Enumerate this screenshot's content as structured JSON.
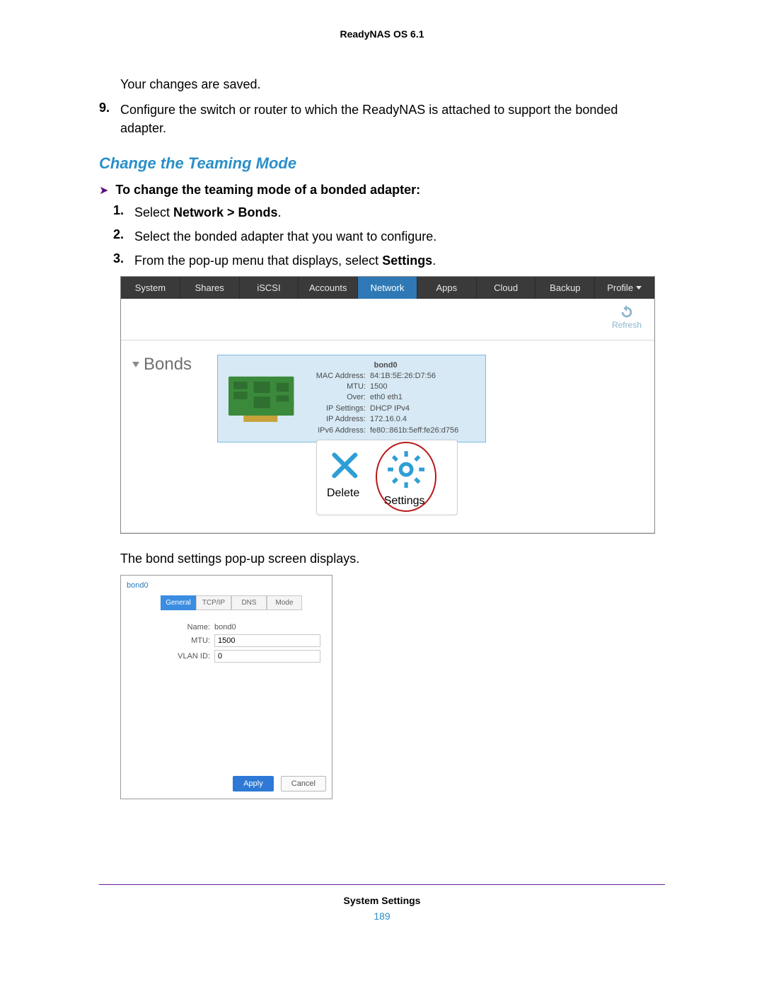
{
  "doc_header": "ReadyNAS OS 6.1",
  "intro_saved": "Your changes are saved.",
  "step9_num": "9.",
  "step9_text": "Configure the switch or router to which the ReadyNAS is attached to support the bonded adapter.",
  "section_title": "Change the Teaming Mode",
  "proc_head": "To change the teaming mode of a bonded adapter:",
  "steps": {
    "s1_num": "1.",
    "s1_pre": "Select ",
    "s1_bold": "Network > Bonds",
    "s1_post": ".",
    "s2_num": "2.",
    "s2_text": "Select the bonded adapter that you want to configure.",
    "s3_num": "3.",
    "s3_pre": "From the pop-up menu that displays, select ",
    "s3_bold": "Settings",
    "s3_post": "."
  },
  "tabs": [
    "System",
    "Shares",
    "iSCSI",
    "Accounts",
    "Network",
    "Apps",
    "Cloud",
    "Backup",
    "Profile"
  ],
  "active_tab_index": 4,
  "refresh_label": "Refresh",
  "bonds_label": "Bonds",
  "bond_card": {
    "title": "bond0",
    "rows": [
      {
        "k": "MAC Address:",
        "v": "84:1B:5E:26:D7:56"
      },
      {
        "k": "MTU:",
        "v": "1500"
      },
      {
        "k": "Over:",
        "v": "eth0 eth1"
      },
      {
        "k": "IP Settings:",
        "v": "DHCP IPv4"
      },
      {
        "k": "IP Address:",
        "v": "172.16.0.4"
      },
      {
        "k": "IPv6 Address:",
        "v": "fe80::861b:5eff:fe26:d756"
      }
    ]
  },
  "popup": {
    "delete": "Delete",
    "settings": "Settings"
  },
  "after1": "The bond settings pop-up screen displays.",
  "dialog": {
    "title": "bond0",
    "tabs": [
      "General",
      "TCP/IP",
      "DNS",
      "Mode"
    ],
    "active_tab_index": 0,
    "name_label": "Name:",
    "name_value": "bond0",
    "mtu_label": "MTU:",
    "mtu_value": "1500",
    "vlan_label": "VLAN ID:",
    "vlan_value": "0",
    "apply": "Apply",
    "cancel": "Cancel"
  },
  "footer_title": "System Settings",
  "page_number": "189"
}
